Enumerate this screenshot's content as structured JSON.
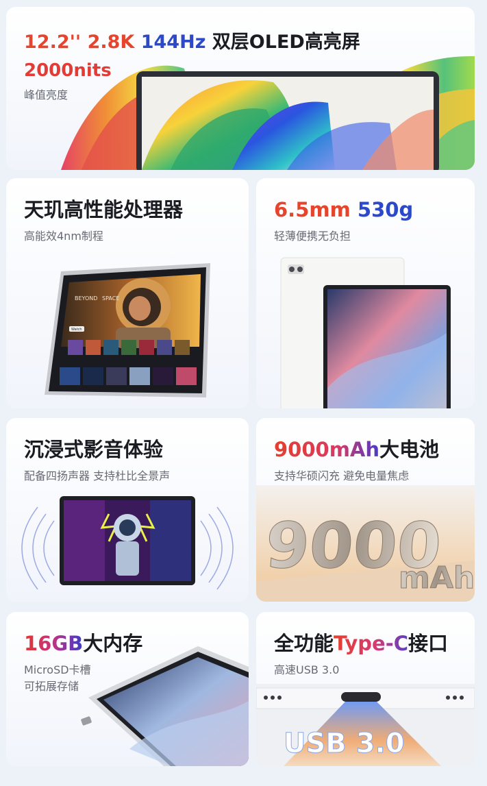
{
  "hero": {
    "spec_size": "12.2''",
    "spec_res": "2.8K",
    "spec_hz": "144Hz",
    "spec_panel": "双层OLED高亮屏",
    "brightness_value": "2000nits",
    "brightness_label": "峰值亮度"
  },
  "cards": {
    "cpu": {
      "title": "天玑高性能处理器",
      "subtitle": "高能效4nm制程"
    },
    "slim": {
      "thickness": "6.5mm",
      "weight": "530g",
      "subtitle": "轻薄便携无负担"
    },
    "audio": {
      "title": "沉浸式影音体验",
      "subtitle": "配备四扬声器 支持杜比全景声"
    },
    "battery": {
      "title_accent": "9000mAh",
      "title_rest": "大电池",
      "subtitle": "支持华硕闪充 避免电量焦虑",
      "big_number": "9000",
      "big_unit": "mAh"
    },
    "memory": {
      "title_accent": "16GB",
      "title_rest": "大内存",
      "subtitle_line1": "MicroSD卡槽",
      "subtitle_line2": "可拓展存储"
    },
    "usb": {
      "title_prefix": "全功能",
      "title_accent": "Type-C",
      "title_suffix": "接口",
      "subtitle": "高速USB 3.0",
      "big_text": "USB 3.0"
    }
  },
  "tablet_ui": {
    "banner_line1": "BEYOND",
    "banner_line2": "SPACE",
    "watch_button": "Watch"
  },
  "colors": {
    "accent_red": "#e6452d",
    "accent_blue": "#2b49c9",
    "card_bg": "#f5f7fc",
    "text_dark": "#1b1b22",
    "text_sub": "#666a73"
  }
}
